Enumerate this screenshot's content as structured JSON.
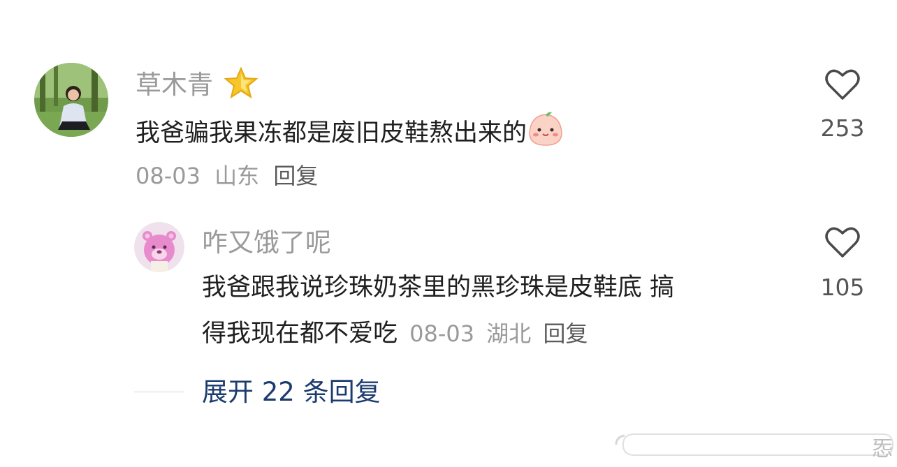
{
  "comments": [
    {
      "username": "草木青",
      "badge_icon": "star-badge-icon",
      "text": "我爸骗我果冻都是废旧皮鞋熬出来的",
      "emoji_icon": "blushing-dumpling-emoji-icon",
      "date": "08-03",
      "location": "山东",
      "reply_label": "回复",
      "like_count": "253"
    }
  ],
  "reply": {
    "username": "咋又饿了呢",
    "text_line1": "我爸跟我说珍珠奶茶里的黑珍珠是皮鞋底 搞",
    "text_line2": "得我现在都不爱吃",
    "date": "08-03",
    "location": "湖北",
    "reply_label": "回复",
    "like_count": "105"
  },
  "expand_label": "展开 22 条回复",
  "watermark_char": "㤅",
  "colors": {
    "username": "#9a9a9a",
    "text": "#1f1f1f",
    "meta": "#9a9a9a",
    "expand_link": "#1c3b6e",
    "like_count": "#555555"
  }
}
